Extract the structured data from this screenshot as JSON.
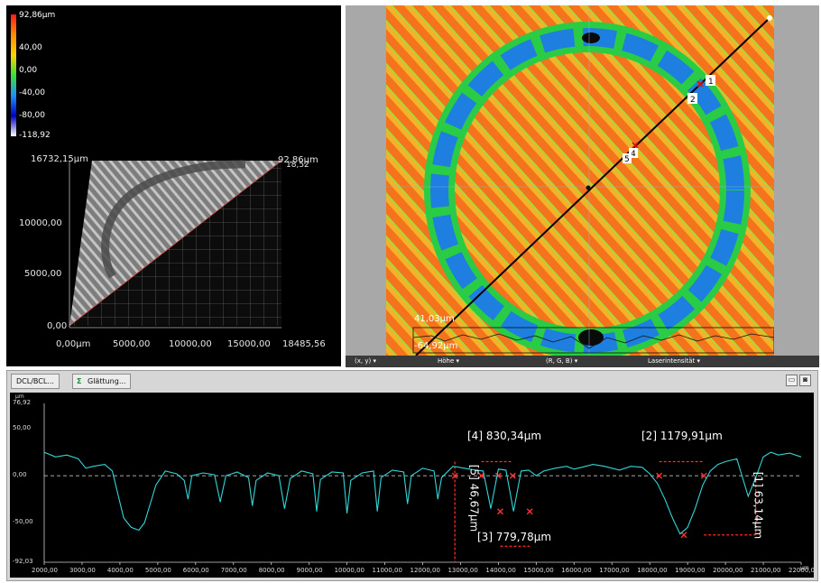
{
  "view3d": {
    "colorbar": {
      "labels": [
        "92,86µm",
        "40,00",
        "0,00",
        "-40,00",
        "-80,00",
        "-118,92"
      ],
      "colors": [
        "#ff1a1a",
        "#ff8c00",
        "#ffd400",
        "#39e039",
        "#1f8fff",
        "#0000c8",
        "#ffffff"
      ]
    },
    "axis": {
      "y_top": "16732,15µm",
      "top_right": "92,86µm",
      "top_right_overlap": "18,52",
      "y_ticks": [
        "10000,00",
        "5000,00",
        "0,00"
      ],
      "x_ticks": [
        "0,00µm",
        "5000,00",
        "10000,00",
        "15000,00",
        "18485,56"
      ]
    }
  },
  "map": {
    "markers": [
      "1",
      "2",
      "4",
      "5"
    ],
    "inset_max": "41,03µm",
    "inset_min": "-64,92µm"
  },
  "statusbar": {
    "items": [
      {
        "label": "(x, y)",
        "arrow": "▾"
      },
      {
        "label": "Höhe",
        "arrow": "▾"
      },
      {
        "label": "(R, G, B)",
        "arrow": "▾"
      },
      {
        "label": "Laserintensität",
        "arrow": "▾"
      }
    ]
  },
  "profile_panel": {
    "tabs": [
      "DCL/BCL...",
      "Glättung..."
    ],
    "window_buttons": [
      "▭",
      "◙"
    ],
    "unit_y": "µm",
    "unit_x": "µm",
    "y_ticks": [
      "76,92",
      "50,00",
      "0,00",
      "-50,00",
      "-92,03"
    ],
    "x_ticks": [
      "2000,00",
      "3000,00",
      "4000,00",
      "5000,00",
      "6000,00",
      "7000,00",
      "8000,00",
      "9000,00",
      "10000,00",
      "11000,00",
      "12000,00",
      "13000,00",
      "14000,00",
      "15000,00",
      "16000,00",
      "17000,00",
      "18000,00",
      "19000,00",
      "20000,00",
      "21000,00",
      "22000,00"
    ],
    "measurements": {
      "m1": "[1] 63,14µm",
      "m2": "[2] 1179,91µm",
      "m3": "[3] 779,78µm",
      "m4": "[4] 830,34µm",
      "m5": "[5] 46,67µm"
    }
  },
  "chart_data": {
    "type": "line",
    "title": "",
    "xlabel": "µm",
    "ylabel": "µm",
    "xlim": [
      2000,
      22000
    ],
    "ylim": [
      -92.03,
      76.92
    ],
    "series": [
      {
        "color": "#33d6d6",
        "x": [
          2000,
          2300,
          2600,
          2900,
          3100,
          3300,
          3600,
          3800,
          3950,
          4100,
          4300,
          4500,
          4650,
          4800,
          4950,
          5200,
          5500,
          5700,
          5800,
          5900,
          6200,
          6500,
          6650,
          6800,
          7100,
          7400,
          7500,
          7600,
          7900,
          8200,
          8350,
          8500,
          8800,
          9100,
          9200,
          9300,
          9600,
          9900,
          10000,
          10100,
          10400,
          10700,
          10800,
          10900,
          11200,
          11500,
          11600,
          11700,
          12000,
          12300,
          12400,
          12500,
          12800,
          13100,
          13400,
          13600,
          13800,
          14000,
          14200,
          14400,
          14600,
          14800,
          15000,
          15200,
          15500,
          15800,
          16000,
          16200,
          16500,
          16800,
          17000,
          17200,
          17500,
          17800,
          18000,
          18200,
          18400,
          18600,
          18800,
          19000,
          19200,
          19400,
          19600,
          19800,
          20000,
          20300,
          20600,
          20800,
          21000,
          21200,
          21400,
          21700,
          22000
        ],
        "y": [
          25,
          20,
          22,
          18,
          8,
          10,
          12,
          5,
          -20,
          -45,
          -55,
          -58,
          -50,
          -30,
          -10,
          5,
          2,
          -5,
          -25,
          0,
          3,
          1,
          -28,
          0,
          4,
          -2,
          -32,
          -5,
          3,
          0,
          -35,
          -3,
          5,
          2,
          -38,
          -4,
          4,
          3,
          -40,
          -5,
          3,
          5,
          -38,
          -2,
          6,
          4,
          -30,
          0,
          8,
          5,
          -25,
          -2,
          10,
          8,
          6,
          5,
          -35,
          7,
          6,
          -38,
          5,
          6,
          0,
          5,
          8,
          10,
          7,
          9,
          12,
          10,
          8,
          6,
          10,
          9,
          2,
          -8,
          -25,
          -45,
          -62,
          -55,
          -35,
          -10,
          5,
          12,
          15,
          18,
          -22,
          -2,
          20,
          25,
          22,
          24,
          20
        ]
      }
    ]
  }
}
